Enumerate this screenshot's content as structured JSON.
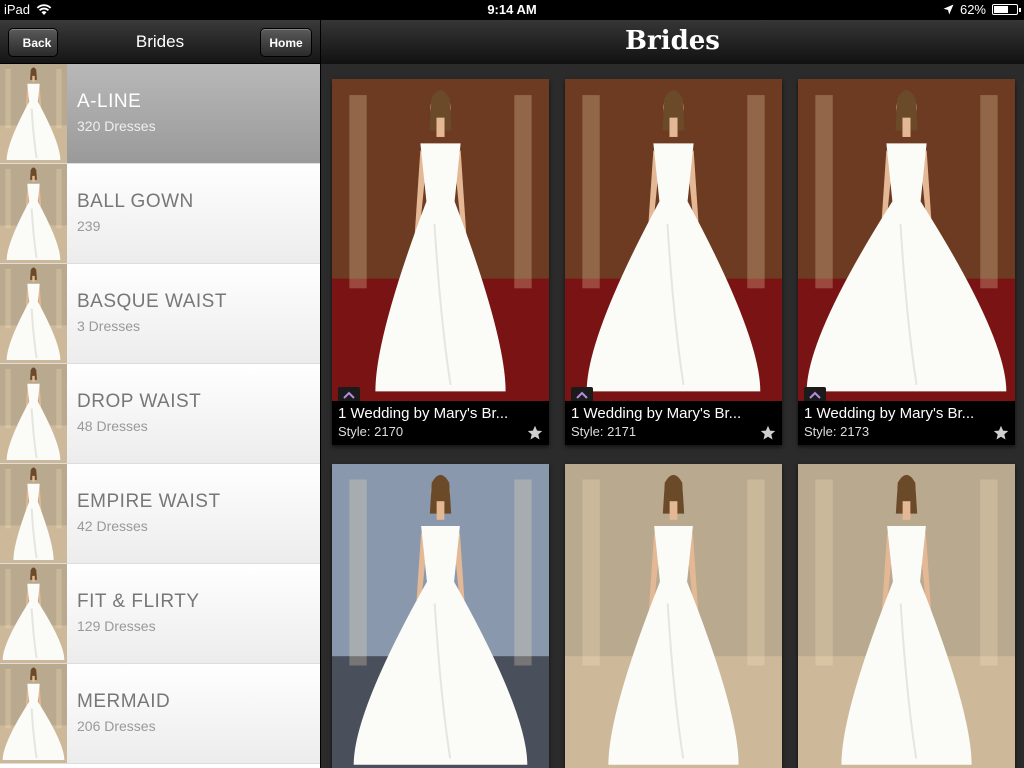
{
  "status": {
    "carrier": "iPad",
    "time": "9:14 AM",
    "battery": "62%",
    "battery_level": 0.62
  },
  "left_nav": {
    "back_label": "Back",
    "title": "Brides",
    "home_label": "Home"
  },
  "right_nav": {
    "title": "Brides"
  },
  "categories": [
    {
      "name": "A-LINE",
      "count": "320 Dresses",
      "selected": true
    },
    {
      "name": "BALL GOWN",
      "count": "239"
    },
    {
      "name": "BASQUE WAIST",
      "count": "3 Dresses"
    },
    {
      "name": "DROP WAIST",
      "count": "48 Dresses"
    },
    {
      "name": "EMPIRE WAIST",
      "count": "42 Dresses"
    },
    {
      "name": "FIT & FLIRTY",
      "count": "129 Dresses"
    },
    {
      "name": "MERMAID",
      "count": "206 Dresses"
    }
  ],
  "dresses": [
    {
      "title": "1 Wedding by Mary's Br...",
      "style": "Style: 2170"
    },
    {
      "title": "1 Wedding by Mary's Br...",
      "style": "Style: 2171"
    },
    {
      "title": "1 Wedding by Mary's Br...",
      "style": "Style: 2173"
    },
    {
      "title": "",
      "style": ""
    },
    {
      "title": "",
      "style": ""
    },
    {
      "title": "",
      "style": ""
    }
  ],
  "colors": {
    "grid_bg": "#2b2b2b",
    "selected_row": "#a8a8a8",
    "caption_bg": "#000000"
  },
  "icons": {
    "wifi": "wifi-icon",
    "location": "location-arrow-icon",
    "star": "star-icon",
    "expand": "chevron-up-icon"
  }
}
